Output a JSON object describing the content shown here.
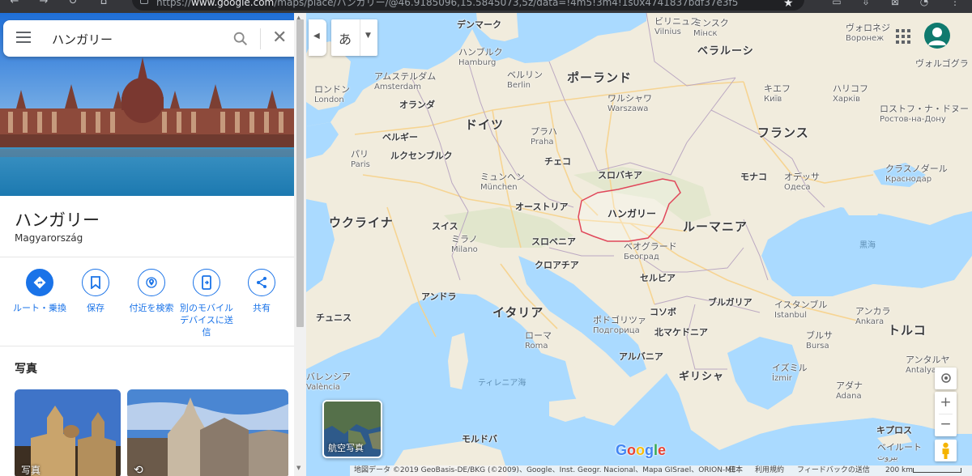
{
  "browser": {
    "url_prefix": "https://",
    "url_host": "www.google.com",
    "url_rest": "/maps/place/ハンガリー/@46.9185096,15.5845073,5z/data=!4m5!3m4!1s0x4741837bdf37e3f5"
  },
  "search": {
    "menu_icon": "hamburger-menu-icon",
    "query": "ハンガリー",
    "search_icon": "search-icon",
    "close_icon": "close-icon"
  },
  "place": {
    "name": "ハンガリー",
    "native_name": "Magyarország"
  },
  "actions": [
    {
      "id": "directions",
      "icon": "directions-icon",
      "label": "ルート・乗換"
    },
    {
      "id": "save",
      "icon": "bookmark-icon",
      "label": "保存"
    },
    {
      "id": "nearby",
      "icon": "nearby-search-icon",
      "label": "付近を検索"
    },
    {
      "id": "send",
      "icon": "send-to-phone-icon",
      "label": "別のモバイルデバイスに送信"
    },
    {
      "id": "share",
      "icon": "share-icon",
      "label": "共有"
    }
  ],
  "photos": {
    "section_title": "写真",
    "items": [
      {
        "label": "写真"
      },
      {
        "label": ""
      }
    ]
  },
  "map_controls": {
    "ime_char": "あ",
    "aerial_label": "航空写真",
    "zoom_in": "+",
    "zoom_out": "−"
  },
  "map_labels": {
    "countries": [
      {
        "key": "poland",
        "text": "ポーランド"
      },
      {
        "key": "germany",
        "text": "ドイツ"
      },
      {
        "key": "france",
        "text": "フランス"
      },
      {
        "key": "ukraine",
        "text": "ウクライナ"
      },
      {
        "key": "romania",
        "text": "ルーマニア"
      },
      {
        "key": "italy",
        "text": "イタリア"
      },
      {
        "key": "turkey",
        "text": "トルコ"
      },
      {
        "key": "belarus",
        "text": "ベラルーシ"
      }
    ],
    "regions": [
      {
        "key": "denmark",
        "text": "デンマーク"
      },
      {
        "key": "netherlands",
        "text": "オランダ"
      },
      {
        "key": "belgium",
        "text": "ベルギー"
      },
      {
        "key": "luxembourg",
        "text": "ルクセンブルク"
      },
      {
        "key": "czech",
        "text": "チェコ"
      },
      {
        "key": "slovakia",
        "text": "スロバキア"
      },
      {
        "key": "austria",
        "text": "オーストリア"
      },
      {
        "key": "switzerland",
        "text": "スイス"
      },
      {
        "key": "slovenia",
        "text": "スロベニア"
      },
      {
        "key": "croatia",
        "text": "クロアチア"
      },
      {
        "key": "serbia",
        "text": "セルビア"
      },
      {
        "key": "bulgaria",
        "text": "ブルガリア"
      },
      {
        "key": "bosnia",
        "text": "コソボ"
      },
      {
        "key": "north_macedonia",
        "text": "北マケドニア"
      },
      {
        "key": "albania",
        "text": "アルバニア"
      },
      {
        "key": "greece",
        "text": "ギリシャ"
      },
      {
        "key": "moldova",
        "text": "モルドバ"
      },
      {
        "key": "monaco",
        "text": "モナコ"
      },
      {
        "key": "andorra",
        "text": "アンドラ"
      },
      {
        "key": "tunisia",
        "text": "チュニス"
      },
      {
        "key": "cyprus",
        "text": "キプロス"
      }
    ],
    "highlight": "ハンガリー",
    "cities": [
      {
        "key": "vilnius",
        "text": "ビリニュス",
        "sub": "Vilnius"
      },
      {
        "key": "minsk",
        "text": "ミンスク",
        "sub": "Мінск"
      },
      {
        "key": "voronezh",
        "text": "ヴォロネジ",
        "sub": "Воронеж"
      },
      {
        "key": "volgograd",
        "text": "ヴォルゴグラ",
        "sub": ""
      },
      {
        "key": "hamburg",
        "text": "ハンブルク",
        "sub": "Hamburg"
      },
      {
        "key": "amsterdam",
        "text": "アムステルダム",
        "sub": "Amsterdam"
      },
      {
        "key": "berlin",
        "text": "ベルリン",
        "sub": "Berlin"
      },
      {
        "key": "london",
        "text": "ロンドン",
        "sub": "London"
      },
      {
        "key": "warsaw",
        "text": "ワルシャワ",
        "sub": "Warszawa"
      },
      {
        "key": "kyiv",
        "text": "キエフ",
        "sub": "Київ"
      },
      {
        "key": "kharkiv",
        "text": "ハリコフ",
        "sub": "Харків"
      },
      {
        "key": "rostov",
        "text": "ロストフ・ナ・ドヌー",
        "sub": "Ростов-на-Дону"
      },
      {
        "key": "paris",
        "text": "パリ",
        "sub": "Paris"
      },
      {
        "key": "prague",
        "text": "プラハ",
        "sub": "Praha"
      },
      {
        "key": "munich",
        "text": "ミュンヘン",
        "sub": "München"
      },
      {
        "key": "krasnodar",
        "text": "クラスノダール",
        "sub": "Краснодар"
      },
      {
        "key": "odessa",
        "text": "オデッサ",
        "sub": "Одеса"
      },
      {
        "key": "milan",
        "text": "ミラノ",
        "sub": "Milano"
      },
      {
        "key": "belgrade",
        "text": "ベオグラード",
        "sub": "Београд"
      },
      {
        "key": "istanbul",
        "text": "イスタンブル",
        "sub": "Istanbul"
      },
      {
        "key": "ankara",
        "text": "アンカラ",
        "sub": "Ankara"
      },
      {
        "key": "podgorica",
        "text": "ポドゴリツァ",
        "sub": "Подгорица"
      },
      {
        "key": "rome",
        "text": "ローマ",
        "sub": "Roma"
      },
      {
        "key": "bursa",
        "text": "ブルサ",
        "sub": "Bursa"
      },
      {
        "key": "izmir",
        "text": "イズミル",
        "sub": "İzmir"
      },
      {
        "key": "adana",
        "text": "アダナ",
        "sub": "Adana"
      },
      {
        "key": "antalya",
        "text": "アンタルヤ",
        "sub": "Antalya"
      },
      {
        "key": "valencia",
        "text": "バレンシア",
        "sub": "València"
      },
      {
        "key": "beirut",
        "text": "ベイルート",
        "sub": "بيروت"
      }
    ],
    "seas": [
      {
        "key": "black_sea",
        "text": "黒海"
      },
      {
        "key": "tyrrhenian",
        "text": "ティレニア海"
      }
    ]
  },
  "attribution": {
    "data": "地図データ ©2019 GeoBasis-DE/BKG (©2009)、Google、Inst. Geogr. Nacional、Mapa GISrael、ORION-ME",
    "region": "日本",
    "terms": "利用規約",
    "feedback": "フィードバックの送信",
    "scale": "200 km"
  },
  "colors": {
    "accent": "#1a73e8",
    "land": "#f1ecdd",
    "water": "#aadaff",
    "hungary_outline": "#e0475a"
  }
}
